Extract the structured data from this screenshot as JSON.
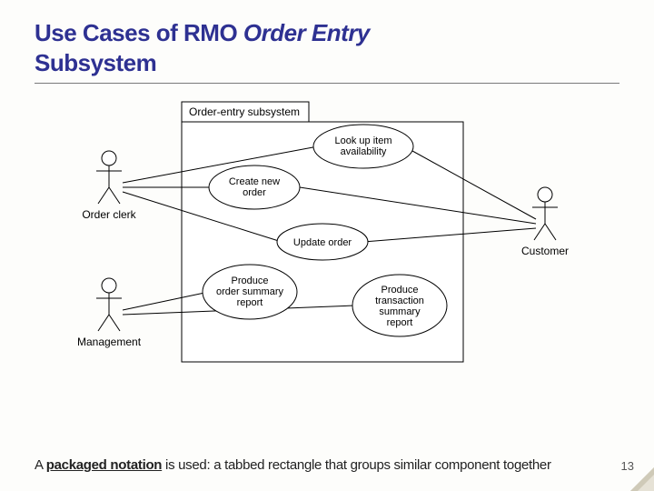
{
  "title": {
    "part1": "Use Cases of RMO ",
    "italic": "Order Entry",
    "part2": " Subsystem"
  },
  "diagram": {
    "package_label": "Order-entry subsystem",
    "actors": {
      "order_clerk": "Order clerk",
      "management": "Management",
      "customer": "Customer"
    },
    "usecases": {
      "lookup": {
        "l1": "Look up item",
        "l2": "availability"
      },
      "create": {
        "l1": "Create new",
        "l2": "order"
      },
      "update": {
        "l1": "Update order"
      },
      "summary": {
        "l1": "Produce",
        "l2": "order summary",
        "l3": "report"
      },
      "transaction": {
        "l1": "Produce",
        "l2": "transaction",
        "l3": "summary",
        "l4": "report"
      }
    }
  },
  "caption": {
    "a": "A ",
    "bold": "packaged notation",
    "b": " is used: a tabbed rectangle that groups similar component together"
  },
  "page_number": "13"
}
